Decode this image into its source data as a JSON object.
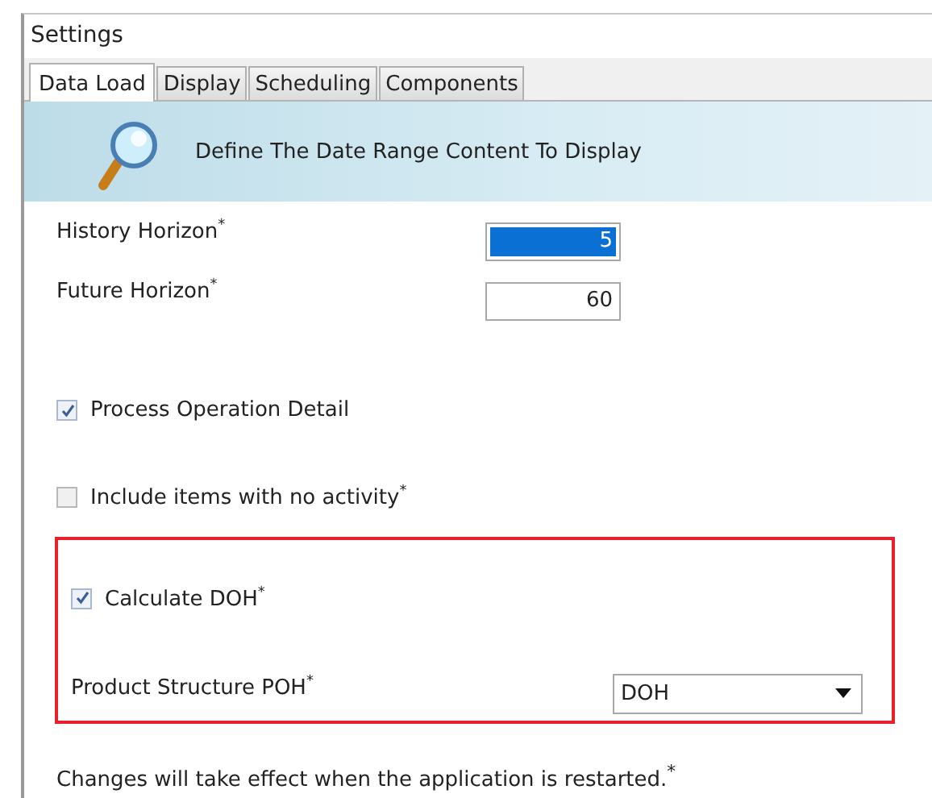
{
  "window": {
    "title": "Settings"
  },
  "tabs": [
    {
      "label": "Data Load",
      "selected": true
    },
    {
      "label": "Display",
      "selected": false
    },
    {
      "label": "Scheduling",
      "selected": false
    },
    {
      "label": "Components",
      "selected": false
    }
  ],
  "banner": {
    "text": "Define The Date Range Content To Display"
  },
  "fields": [
    {
      "label": "History Horizon$^{*}$",
      "value": "5",
      "selected": true
    },
    {
      "label": "Future Horizon$^{*}$",
      "value": "60",
      "selected": false
    }
  ],
  "checkboxes": [
    {
      "label": "Process Operation Detail",
      "checked": true
    },
    {
      "label": "Include items with no activity$^{*}$",
      "checked": false
    }
  ],
  "highlight": {
    "checkbox": {
      "label": "Calculate DOH$^{*}$",
      "checked": true
    },
    "dropdown": {
      "label": "Product Structure POH$^{*}$",
      "value": "DOH"
    }
  },
  "note": "Changes will take effect when the application is restarted.$^{*}$"
}
